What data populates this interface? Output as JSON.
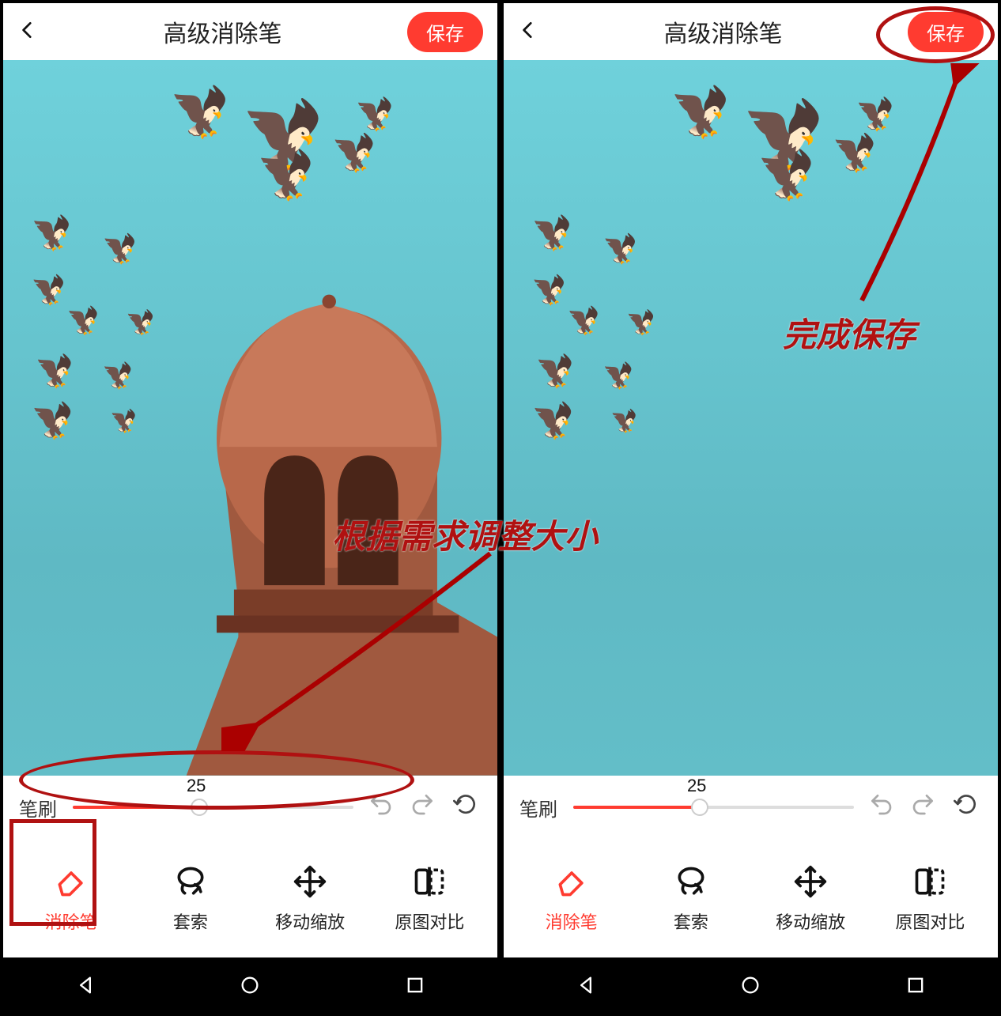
{
  "left": {
    "header": {
      "title": "高级消除笔",
      "save_label": "保存"
    },
    "slider": {
      "label": "笔刷",
      "value": "25"
    },
    "tools": {
      "eraser": "消除笔",
      "lasso": "套索",
      "move": "移动缩放",
      "compare": "原图对比"
    },
    "image_has_tower": true
  },
  "right": {
    "header": {
      "title": "高级消除笔",
      "save_label": "保存"
    },
    "slider": {
      "label": "笔刷",
      "value": "25"
    },
    "tools": {
      "eraser": "消除笔",
      "lasso": "套索",
      "move": "移动缩放",
      "compare": "原图对比"
    },
    "image_has_tower": false
  },
  "annotations": {
    "slider_text": "根据需求调整大小",
    "save_text": "完成保存"
  },
  "icons": {
    "back": "back-chevron",
    "undo": "undo-icon",
    "redo": "redo-icon",
    "reset": "reset-icon",
    "eraser": "eraser-icon",
    "lasso": "lasso-icon",
    "move": "move-icon",
    "compare": "compare-icon",
    "nav_back": "triangle-back",
    "nav_home": "circle-home",
    "nav_recent": "square-recent"
  }
}
